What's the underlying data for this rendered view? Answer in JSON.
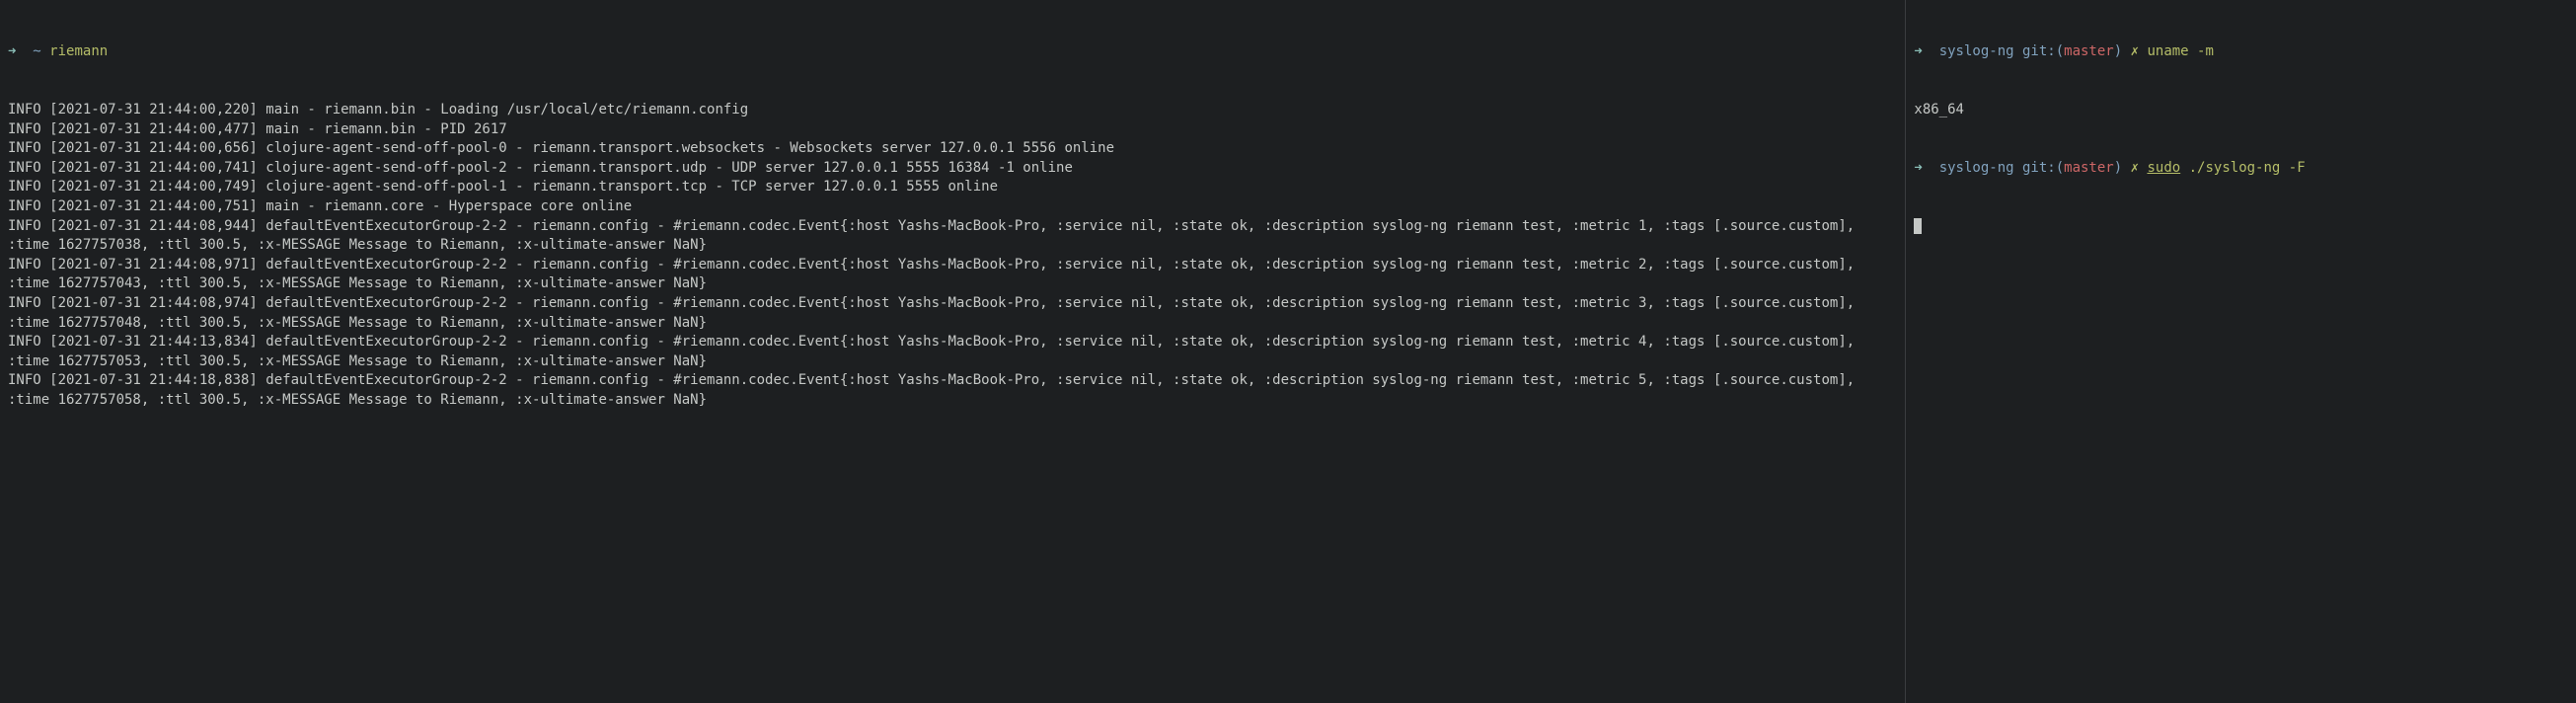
{
  "left": {
    "prompt": {
      "arrow": "➜",
      "tilde": "~",
      "command": "riemann"
    },
    "lines": [
      "INFO [2021-07-31 21:44:00,220] main - riemann.bin - Loading /usr/local/etc/riemann.config",
      "INFO [2021-07-31 21:44:00,477] main - riemann.bin - PID 2617",
      "INFO [2021-07-31 21:44:00,656] clojure-agent-send-off-pool-0 - riemann.transport.websockets - Websockets server 127.0.0.1 5556 online",
      "INFO [2021-07-31 21:44:00,741] clojure-agent-send-off-pool-2 - riemann.transport.udp - UDP server 127.0.0.1 5555 16384 -1 online",
      "INFO [2021-07-31 21:44:00,749] clojure-agent-send-off-pool-1 - riemann.transport.tcp - TCP server 127.0.0.1 5555 online",
      "INFO [2021-07-31 21:44:00,751] main - riemann.core - Hyperspace core online",
      "INFO [2021-07-31 21:44:08,944] defaultEventExecutorGroup-2-2 - riemann.config - #riemann.codec.Event{:host Yashs-MacBook-Pro, :service nil, :state ok, :description syslog-ng riemann test, :metric 1, :tags [.source.custom], :time 1627757038, :ttl 300.5, :x-MESSAGE Message to Riemann, :x-ultimate-answer NaN}",
      "INFO [2021-07-31 21:44:08,971] defaultEventExecutorGroup-2-2 - riemann.config - #riemann.codec.Event{:host Yashs-MacBook-Pro, :service nil, :state ok, :description syslog-ng riemann test, :metric 2, :tags [.source.custom], :time 1627757043, :ttl 300.5, :x-MESSAGE Message to Riemann, :x-ultimate-answer NaN}",
      "INFO [2021-07-31 21:44:08,974] defaultEventExecutorGroup-2-2 - riemann.config - #riemann.codec.Event{:host Yashs-MacBook-Pro, :service nil, :state ok, :description syslog-ng riemann test, :metric 3, :tags [.source.custom], :time 1627757048, :ttl 300.5, :x-MESSAGE Message to Riemann, :x-ultimate-answer NaN}",
      "INFO [2021-07-31 21:44:13,834] defaultEventExecutorGroup-2-2 - riemann.config - #riemann.codec.Event{:host Yashs-MacBook-Pro, :service nil, :state ok, :description syslog-ng riemann test, :metric 4, :tags [.source.custom], :time 1627757053, :ttl 300.5, :x-MESSAGE Message to Riemann, :x-ultimate-answer NaN}",
      "INFO [2021-07-31 21:44:18,838] defaultEventExecutorGroup-2-2 - riemann.config - #riemann.codec.Event{:host Yashs-MacBook-Pro, :service nil, :state ok, :description syslog-ng riemann test, :metric 5, :tags [.source.custom], :time 1627757058, :ttl 300.5, :x-MESSAGE Message to Riemann, :x-ultimate-answer NaN}"
    ]
  },
  "right": {
    "prompt1": {
      "arrow": "➜",
      "dir": "syslog-ng",
      "git_label": "git:(",
      "branch": "master",
      "git_close": ")",
      "x": "✗",
      "command": "uname -m"
    },
    "output1": "x86_64",
    "prompt2": {
      "arrow": "➜",
      "dir": "syslog-ng",
      "git_label": "git:(",
      "branch": "master",
      "git_close": ")",
      "x": "✗",
      "sudo": "sudo",
      "command": " ./syslog-ng -F"
    }
  }
}
